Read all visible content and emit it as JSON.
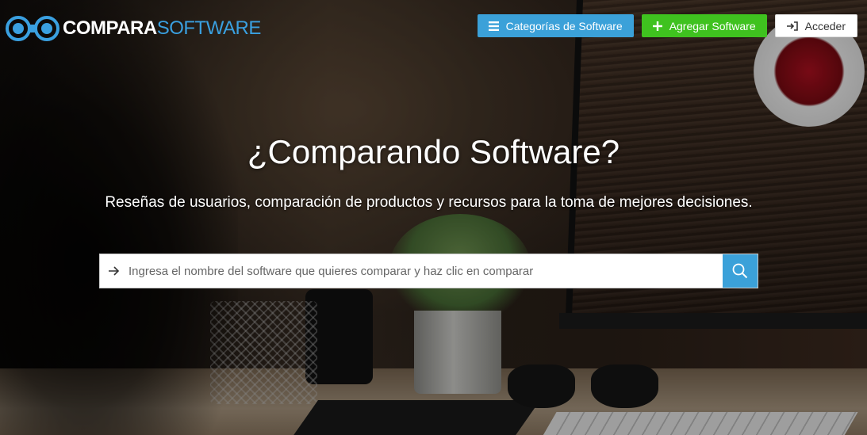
{
  "brand": {
    "name_part1": "COMPARA",
    "name_part2": "SOFTWARE",
    "icon": "binoculars-icon",
    "colors": {
      "primary": "#3ba1d9",
      "white": "#ffffff"
    }
  },
  "nav": {
    "categories": {
      "label": "Categorías de Software",
      "icon": "menu-icon",
      "color": "#3ba1d9"
    },
    "add": {
      "label": "Agregar Software",
      "icon": "plus-icon",
      "color": "#3fc21f"
    },
    "login": {
      "label": "Acceder",
      "icon": "sign-in-icon",
      "color": "#ffffff"
    }
  },
  "hero": {
    "title": "¿Comparando Software?",
    "subtitle": "Reseñas de usuarios, comparación de productos y recursos para la toma de mejores decisiones."
  },
  "search": {
    "placeholder": "Ingresa el nombre del software que quieres comparar y haz clic en comparar",
    "value": "",
    "leading_icon": "arrow-right-icon",
    "submit_icon": "search-icon"
  }
}
